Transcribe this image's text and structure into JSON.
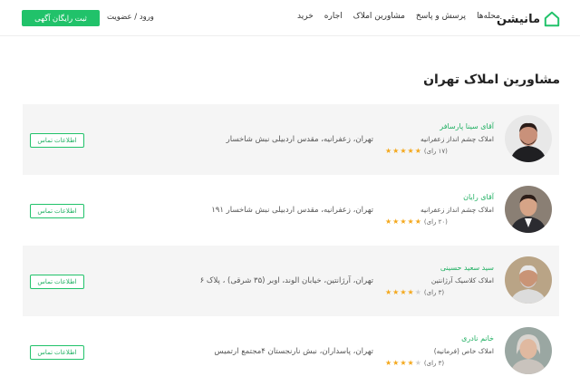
{
  "header": {
    "logo_text": "مانیشن",
    "nav": [
      "خرید",
      "اجاره",
      "مشاورین املاک",
      "پرسش و پاسخ",
      "محله‌ها"
    ],
    "login": "ورود / عضویت",
    "post_ad": "ثبت رایگان آگهی"
  },
  "page_title": "مشاورین املاک تهران",
  "contact_label": "اطلاعات تماس",
  "colors": {
    "accent": "#21c26a",
    "star": "#f4a81c",
    "card_bg": "#f5f5f5"
  },
  "agents": [
    {
      "name": "آقای سینا پارسافر",
      "agency": "املاک چشم انداز زعفرانیه",
      "rating": 5,
      "votes": "(۱۷ رای)",
      "address": "تهران، زعفرانیه، مقدس اردبیلی نبش شاخسار"
    },
    {
      "name": "آقای رایان",
      "agency": "املاک چشم انداز زعفرانیه",
      "rating": 5,
      "votes": "(۲۰ رای)",
      "address": "تهران، زعفرانیه، مقدس اردبیلی نبش شاخسار ۱۹۱"
    },
    {
      "name": "سید سعید حسینی",
      "agency": "املاک کلاسیک آرژانتین",
      "rating": 4,
      "votes": "(۳ رای)",
      "address": "تهران، آرژانتین، خیابان الوند، اوبر (۳۵ شرقی) ، پلاک ۶"
    },
    {
      "name": "خانم نادری",
      "agency": "املاک خاص (فرمانیه)",
      "rating": 4,
      "votes": "(۳ رای)",
      "address": "تهران، پاسداران، نبش نارنجستان ۴مجتمع ارتمیس"
    }
  ]
}
